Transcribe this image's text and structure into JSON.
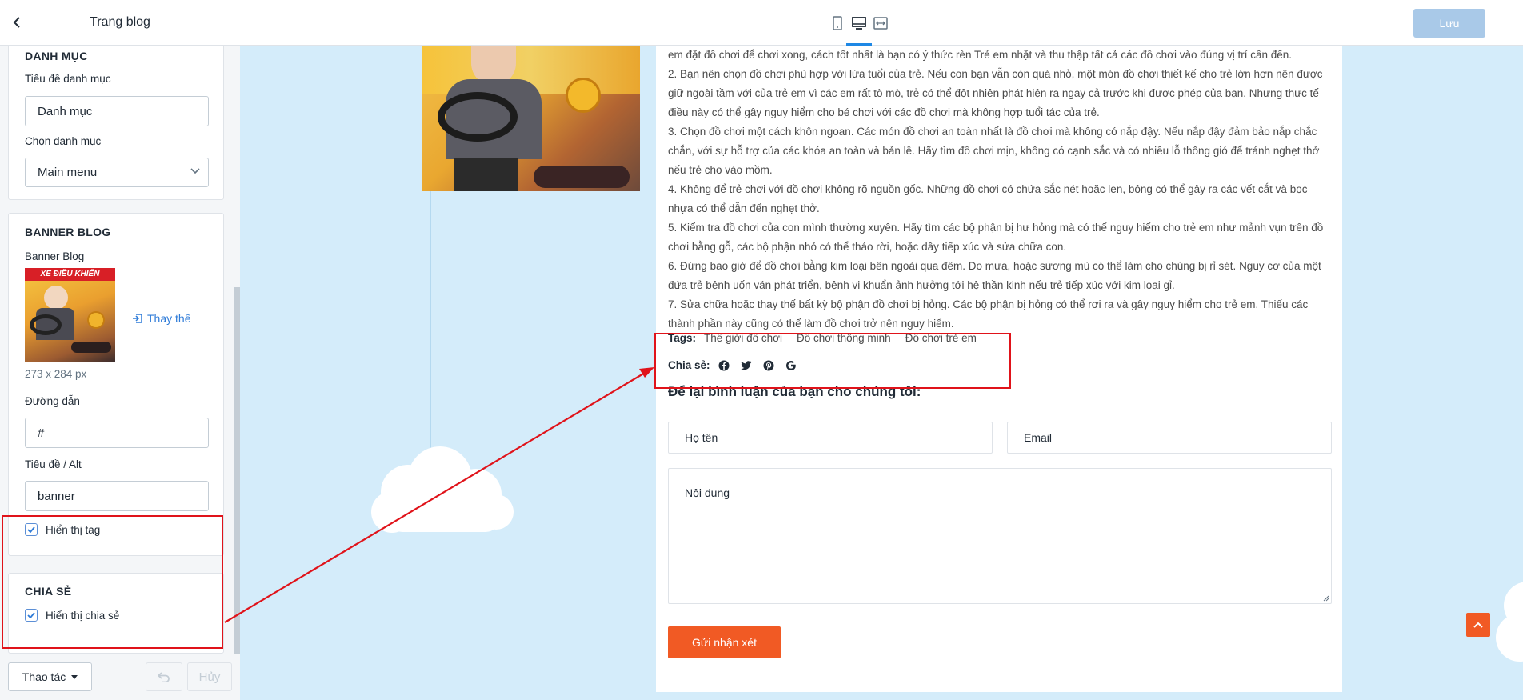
{
  "sidebar": {
    "title": "Trang blog",
    "category_card": {
      "heading_partial": "DANH MỤC",
      "title_label": "Tiêu đề danh mục",
      "title_value": "Danh mục",
      "select_label": "Chọn danh mục",
      "select_value": "Main menu"
    },
    "banner_card": {
      "heading": "BANNER BLOG",
      "image_label": "Banner Blog",
      "image_caption": "XE ĐIỀU KHIỂN",
      "replace_label": "Thay thế",
      "image_size": "273 x 284 px",
      "link_label": "Đường dẫn",
      "link_value": "#",
      "alt_label": "Tiêu đề / Alt",
      "alt_value": "banner",
      "show_tag_label": "Hiển thị tag",
      "show_tag_checked": true
    },
    "share_card": {
      "heading": "CHIA SẺ",
      "show_share_label": "Hiển thị chia sẻ",
      "show_share_checked": true
    },
    "footer": {
      "actions_label": "Thao tác",
      "cancel_label": "Hủy"
    }
  },
  "topbar": {
    "save_label": "Lưu",
    "devices": [
      "mobile-icon",
      "desktop-icon",
      "fullwidth-icon"
    ],
    "active_device": "desktop-icon"
  },
  "article": {
    "paragraphs": [
      "em đặt đồ chơi để chơi xong, cách tốt nhất là bạn có ý thức rèn Trẻ em nhặt và thu thập tất cả các đồ chơi vào đúng vị trí cần đến.",
      "2. Bạn nên chọn đồ chơi phù hợp với lứa tuổi của trẻ. Nếu con bạn vẫn còn quá nhỏ, một món đồ chơi thiết kế cho trẻ lớn hơn nên được giữ ngoài tầm với của trẻ em vì các em rất tò mò, trẻ có thể đột nhiên phát hiện ra ngay cả trước khi được phép của bạn. Nhưng thực tế điều này có thể gây nguy hiểm cho bé chơi với các đồ chơi mà không hợp tuổi tác của trẻ.",
      "3. Chọn đồ chơi một cách khôn ngoan. Các món đồ chơi an toàn nhất là đồ chơi mà không có nắp đậy. Nếu nắp đậy đảm bảo nắp chắc chắn, với sự hỗ trợ của các khóa an toàn và bản lề. Hãy tìm đồ chơi mịn, không có cạnh sắc và có nhiều lỗ thông gió để tránh nghẹt thở nếu trẻ cho vào mồm.",
      "4. Không để trẻ chơi với đồ chơi không rõ nguồn gốc. Những đồ chơi có chứa sắc nét hoặc len, bông có thể gây ra các vết cắt và bọc nhựa có thể dẫn đến nghẹt thở.",
      "5. Kiểm tra đồ chơi của con mình thường xuyên. Hãy tìm các bộ phận bị hư hỏng mà có thể nguy hiểm cho trẻ em như mảnh vụn trên đồ chơi bằng gỗ, các bộ phận nhỏ có thể tháo rời, hoặc dây tiếp xúc và sửa chữa con.",
      "6. Đừng bao giờ để đồ chơi bằng kim loại bên ngoài qua đêm. Do mưa, hoặc sương mù có thể làm cho chúng bị rỉ sét. Nguy cơ của một đứa trẻ bệnh uốn ván phát triển, bệnh vi khuẩn ảnh hưởng tới hệ thần kinh nếu trẻ tiếp xúc với kim loại gỉ.",
      "7. Sửa chữa hoặc thay thế bất kỳ bộ phận đồ chơi bị hỏng. Các bộ phận bị hỏng có thể rơi ra và gây nguy hiểm cho trẻ em. Thiếu các thành phần này cũng có thể làm đồ chơi trở nên nguy hiểm."
    ],
    "tags_label": "Tags:",
    "tags": [
      "Thế giới đồ chơi",
      "Đồ chơi thông minh",
      "Đồ chơi trẻ em"
    ],
    "share_label": "Chia sẻ:",
    "share_icons": [
      "facebook-icon",
      "twitter-icon",
      "pinterest-icon",
      "google-icon"
    ],
    "comment_title": "Để lại bình luận của bạn cho chúng tôi:",
    "name_placeholder": "Họ tên",
    "email_placeholder": "Email",
    "content_placeholder": "Nội dung",
    "submit_label": "Gửi nhận xét"
  },
  "colors": {
    "accent_orange": "#f15a24",
    "canvas_bg": "#d4ecfa",
    "annotation_red": "#e0131a",
    "save_disabled": "#a9c9e8"
  }
}
